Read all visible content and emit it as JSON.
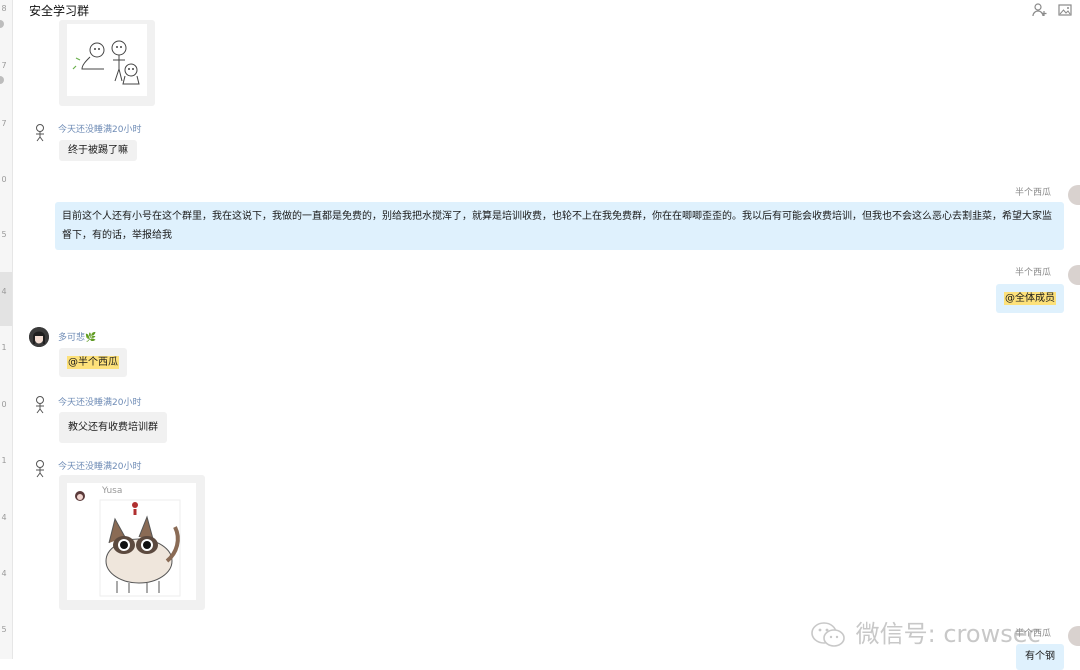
{
  "chat": {
    "title": "安全学习群",
    "icons": {
      "add_member": "add-member-icon",
      "screenshot": "screenshot-icon"
    }
  },
  "sidebar_fragments": [
    "8",
    "7",
    "7",
    "0",
    "5",
    "4",
    "1",
    "0",
    "1",
    "4",
    "4",
    "5"
  ],
  "messages": [
    {
      "type": "image",
      "direction": "in",
      "image": "meme-stick-figures"
    },
    {
      "type": "text",
      "direction": "in",
      "sender": "今天还没睡满20小时",
      "text": "终于被踢了嘛"
    },
    {
      "type": "text",
      "direction": "out",
      "sender": "半个西瓜",
      "text": "目前这个人还有小号在这个群里，我在这说下，我做的一直都是免费的，别给我把水搅浑了，就算是培训收费，也轮不上在我免费群，你在在唧唧歪歪的。我以后有可能会收费培训，但我也不会这么恶心去割韭菜，希望大家监督下，有的话，举报给我"
    },
    {
      "type": "mention",
      "direction": "out",
      "sender": "半个西瓜",
      "text": "@全体成员"
    },
    {
      "type": "mention",
      "direction": "in",
      "sender": "多可悲",
      "sender_emoji": "🌿",
      "text": "@半个西瓜"
    },
    {
      "type": "text",
      "direction": "in",
      "sender": "今天还没睡满20小时",
      "text": "教父还有收费培训群"
    },
    {
      "type": "image",
      "direction": "in",
      "sender": "今天还没睡满20小时",
      "image": "cat-sticker",
      "image_caption": "Yusa"
    },
    {
      "type": "text",
      "direction": "out",
      "sender": "半个西瓜",
      "text": "有个钢"
    }
  ],
  "watermark": {
    "prefix": "微信号: ",
    "account": "crowsec"
  }
}
